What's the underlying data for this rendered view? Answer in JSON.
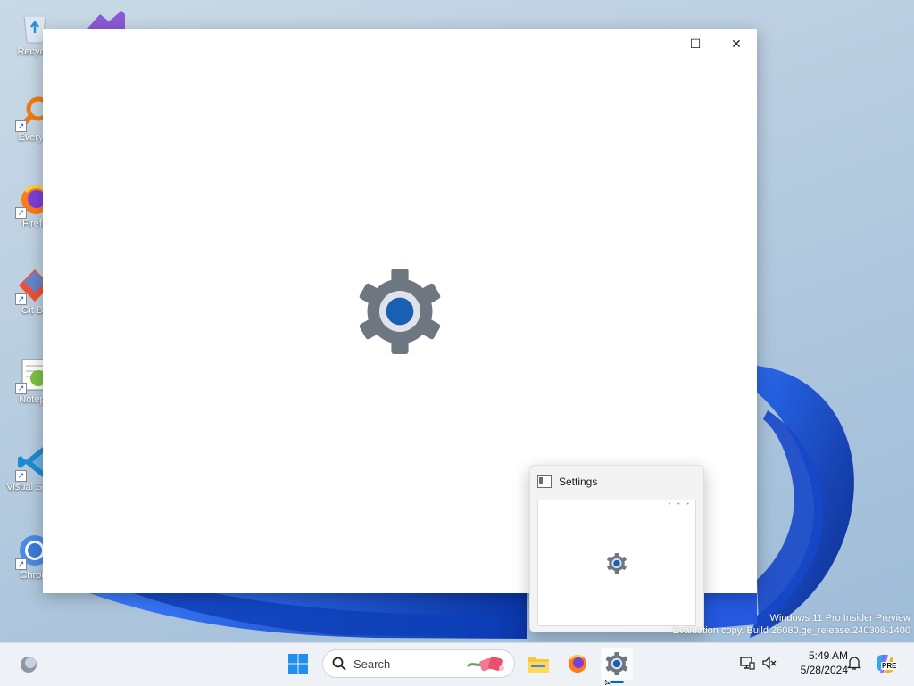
{
  "desktop": {
    "icons": [
      {
        "label": "Recycle"
      },
      {
        "label": "Everyth"
      },
      {
        "label": "Firefo"
      },
      {
        "label": "Git Ba"
      },
      {
        "label": "Notepa"
      },
      {
        "label": "Visual S Cod"
      },
      {
        "label": "Chrom"
      }
    ]
  },
  "window": {
    "minimize_glyph": "—",
    "maximize_glyph": "☐",
    "close_glyph": "✕"
  },
  "preview": {
    "title": "Settings",
    "dots": "• • •"
  },
  "watermark": {
    "line1": "Windows 11 Pro Insider Preview",
    "line2": "Evaluation copy. Build 26080.ge_release.240308-1400"
  },
  "taskbar": {
    "search_placeholder": "Search",
    "time": "5:49 AM",
    "date": "5/28/2024",
    "copilot_badge": "PRE"
  },
  "colors": {
    "accent": "#0067c0",
    "gear_body": "#6e7681",
    "gear_core": "#1a5fb4"
  }
}
